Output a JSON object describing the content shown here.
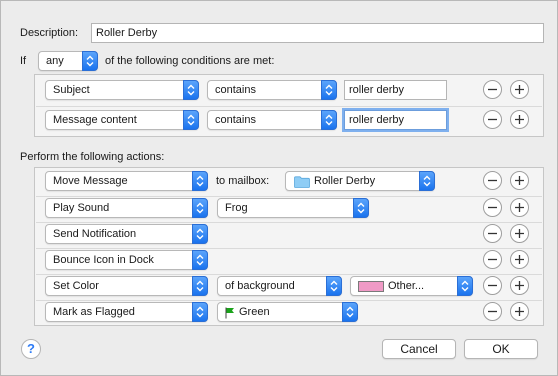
{
  "description": {
    "label": "Description:",
    "value": "Roller Derby"
  },
  "conditions_header": {
    "prefix": "If",
    "match": "any",
    "suffix": "of the following conditions are met:"
  },
  "conditions": [
    {
      "field": "Subject",
      "operator": "contains",
      "value": "roller derby"
    },
    {
      "field": "Message content",
      "operator": "contains",
      "value": "roller derby"
    }
  ],
  "actions_header": "Perform the following actions:",
  "actions": [
    {
      "action": "Move Message",
      "connector": "to mailbox:",
      "target": "Roller Derby",
      "target_icon": "folder-icon"
    },
    {
      "action": "Play Sound",
      "target": "Frog"
    },
    {
      "action": "Send Notification"
    },
    {
      "action": "Bounce Icon in Dock"
    },
    {
      "action": "Set Color",
      "option": "of background",
      "color_label": "Other...",
      "color": "#f09ac6"
    },
    {
      "action": "Mark as Flagged",
      "flag_label": "Green",
      "flag_color": "#1aa31a"
    }
  ],
  "buttons": {
    "help": "?",
    "cancel": "Cancel",
    "ok": "OK"
  },
  "colors": {
    "accent": "#1a73ee",
    "window": "#ececec"
  }
}
